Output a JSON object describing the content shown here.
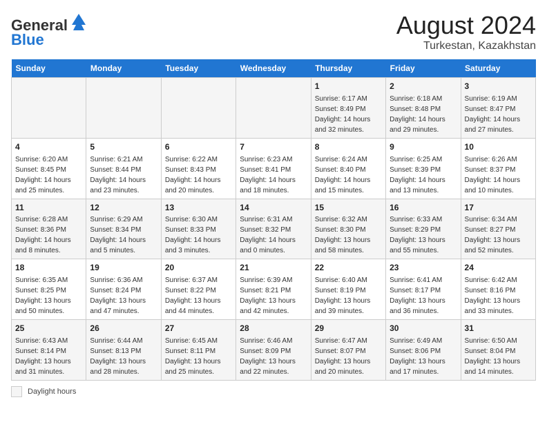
{
  "header": {
    "logo_line1": "General",
    "logo_line2": "Blue",
    "month_year": "August 2024",
    "location": "Turkestan, Kazakhstan"
  },
  "footer": {
    "daylight_label": "Daylight hours"
  },
  "weekdays": [
    "Sunday",
    "Monday",
    "Tuesday",
    "Wednesday",
    "Thursday",
    "Friday",
    "Saturday"
  ],
  "weeks": [
    [
      {
        "day": "",
        "info": ""
      },
      {
        "day": "",
        "info": ""
      },
      {
        "day": "",
        "info": ""
      },
      {
        "day": "",
        "info": ""
      },
      {
        "day": "1",
        "info": "Sunrise: 6:17 AM\nSunset: 8:49 PM\nDaylight: 14 hours and 32 minutes."
      },
      {
        "day": "2",
        "info": "Sunrise: 6:18 AM\nSunset: 8:48 PM\nDaylight: 14 hours and 29 minutes."
      },
      {
        "day": "3",
        "info": "Sunrise: 6:19 AM\nSunset: 8:47 PM\nDaylight: 14 hours and 27 minutes."
      }
    ],
    [
      {
        "day": "4",
        "info": "Sunrise: 6:20 AM\nSunset: 8:45 PM\nDaylight: 14 hours and 25 minutes."
      },
      {
        "day": "5",
        "info": "Sunrise: 6:21 AM\nSunset: 8:44 PM\nDaylight: 14 hours and 23 minutes."
      },
      {
        "day": "6",
        "info": "Sunrise: 6:22 AM\nSunset: 8:43 PM\nDaylight: 14 hours and 20 minutes."
      },
      {
        "day": "7",
        "info": "Sunrise: 6:23 AM\nSunset: 8:41 PM\nDaylight: 14 hours and 18 minutes."
      },
      {
        "day": "8",
        "info": "Sunrise: 6:24 AM\nSunset: 8:40 PM\nDaylight: 14 hours and 15 minutes."
      },
      {
        "day": "9",
        "info": "Sunrise: 6:25 AM\nSunset: 8:39 PM\nDaylight: 14 hours and 13 minutes."
      },
      {
        "day": "10",
        "info": "Sunrise: 6:26 AM\nSunset: 8:37 PM\nDaylight: 14 hours and 10 minutes."
      }
    ],
    [
      {
        "day": "11",
        "info": "Sunrise: 6:28 AM\nSunset: 8:36 PM\nDaylight: 14 hours and 8 minutes."
      },
      {
        "day": "12",
        "info": "Sunrise: 6:29 AM\nSunset: 8:34 PM\nDaylight: 14 hours and 5 minutes."
      },
      {
        "day": "13",
        "info": "Sunrise: 6:30 AM\nSunset: 8:33 PM\nDaylight: 14 hours and 3 minutes."
      },
      {
        "day": "14",
        "info": "Sunrise: 6:31 AM\nSunset: 8:32 PM\nDaylight: 14 hours and 0 minutes."
      },
      {
        "day": "15",
        "info": "Sunrise: 6:32 AM\nSunset: 8:30 PM\nDaylight: 13 hours and 58 minutes."
      },
      {
        "day": "16",
        "info": "Sunrise: 6:33 AM\nSunset: 8:29 PM\nDaylight: 13 hours and 55 minutes."
      },
      {
        "day": "17",
        "info": "Sunrise: 6:34 AM\nSunset: 8:27 PM\nDaylight: 13 hours and 52 minutes."
      }
    ],
    [
      {
        "day": "18",
        "info": "Sunrise: 6:35 AM\nSunset: 8:25 PM\nDaylight: 13 hours and 50 minutes."
      },
      {
        "day": "19",
        "info": "Sunrise: 6:36 AM\nSunset: 8:24 PM\nDaylight: 13 hours and 47 minutes."
      },
      {
        "day": "20",
        "info": "Sunrise: 6:37 AM\nSunset: 8:22 PM\nDaylight: 13 hours and 44 minutes."
      },
      {
        "day": "21",
        "info": "Sunrise: 6:39 AM\nSunset: 8:21 PM\nDaylight: 13 hours and 42 minutes."
      },
      {
        "day": "22",
        "info": "Sunrise: 6:40 AM\nSunset: 8:19 PM\nDaylight: 13 hours and 39 minutes."
      },
      {
        "day": "23",
        "info": "Sunrise: 6:41 AM\nSunset: 8:17 PM\nDaylight: 13 hours and 36 minutes."
      },
      {
        "day": "24",
        "info": "Sunrise: 6:42 AM\nSunset: 8:16 PM\nDaylight: 13 hours and 33 minutes."
      }
    ],
    [
      {
        "day": "25",
        "info": "Sunrise: 6:43 AM\nSunset: 8:14 PM\nDaylight: 13 hours and 31 minutes."
      },
      {
        "day": "26",
        "info": "Sunrise: 6:44 AM\nSunset: 8:13 PM\nDaylight: 13 hours and 28 minutes."
      },
      {
        "day": "27",
        "info": "Sunrise: 6:45 AM\nSunset: 8:11 PM\nDaylight: 13 hours and 25 minutes."
      },
      {
        "day": "28",
        "info": "Sunrise: 6:46 AM\nSunset: 8:09 PM\nDaylight: 13 hours and 22 minutes."
      },
      {
        "day": "29",
        "info": "Sunrise: 6:47 AM\nSunset: 8:07 PM\nDaylight: 13 hours and 20 minutes."
      },
      {
        "day": "30",
        "info": "Sunrise: 6:49 AM\nSunset: 8:06 PM\nDaylight: 13 hours and 17 minutes."
      },
      {
        "day": "31",
        "info": "Sunrise: 6:50 AM\nSunset: 8:04 PM\nDaylight: 13 hours and 14 minutes."
      }
    ]
  ]
}
